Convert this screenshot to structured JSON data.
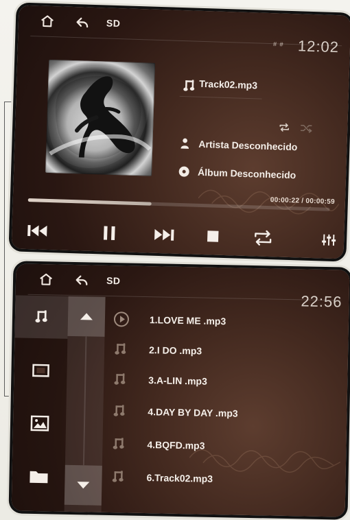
{
  "player": {
    "header": {
      "source_label": "SD",
      "status": "# #",
      "time": "12:02"
    },
    "track": {
      "title": "Track02.mp3",
      "artist": "Artista Desconhecido",
      "album": "Álbum Desconhecido"
    },
    "progress": {
      "text": "00:00:22 / 00:00:59",
      "fraction": 0.41
    },
    "icons": {
      "home": "home-icon",
      "back": "back-icon",
      "music_note": "music-note-icon",
      "artist": "person-icon",
      "album": "disc-icon",
      "previous": "previous-track-icon",
      "pause": "pause-icon",
      "next": "next-track-icon",
      "stop": "stop-icon",
      "repeat": "repeat-icon",
      "equalizer": "equalizer-icon"
    }
  },
  "library": {
    "header": {
      "source_label": "SD",
      "time": "22:56"
    },
    "songs": [
      "1.LOVE ME .mp3",
      "2.I DO .mp3",
      "3.A-LIN .mp3",
      "4.DAY BY DAY .mp3",
      "4.BQFD.mp3",
      "6.Track02.mp3"
    ],
    "icons": {
      "home": "home-icon",
      "back": "back-icon",
      "music": "music-icon",
      "video": "video-icon",
      "image": "image-icon",
      "folder": "folder-icon",
      "scroll_up": "scroll-up-icon",
      "scroll_down": "scroll-down-icon",
      "playing": "playing-icon",
      "song": "music-note-icon"
    }
  }
}
